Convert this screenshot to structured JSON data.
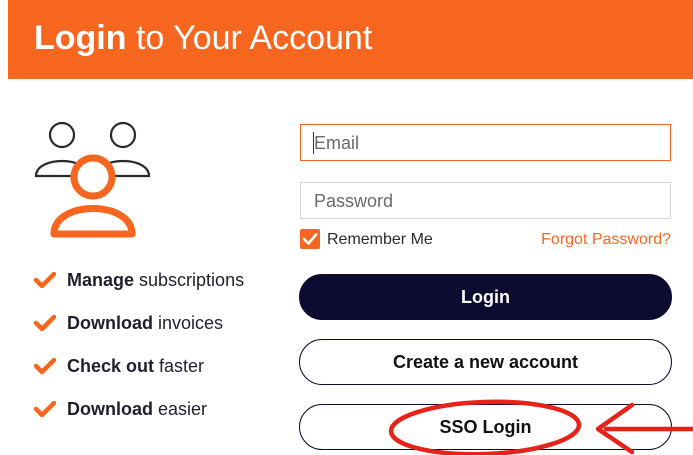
{
  "header": {
    "title_bold": "Login",
    "title_rest": " to Your Account",
    "background": "#f7661f"
  },
  "illustration": {
    "icon": "users-icon"
  },
  "features": [
    {
      "bold": "Manage",
      "rest": " subscriptions"
    },
    {
      "bold": "Download",
      "rest": " invoices"
    },
    {
      "bold": "Check out",
      "rest": " faster"
    },
    {
      "bold": "Download",
      "rest": " easier"
    }
  ],
  "form": {
    "email_placeholder": "Email",
    "password_placeholder": "Password",
    "remember_label": "Remember Me",
    "remember_checked": true,
    "forgot_label": "Forgot Password?",
    "login_label": "Login",
    "create_label": "Create a new account",
    "sso_label": "SSO Login"
  },
  "colors": {
    "accent": "#f7661f",
    "button_dark": "#0e0b30",
    "annotation_red": "#e5231b"
  }
}
